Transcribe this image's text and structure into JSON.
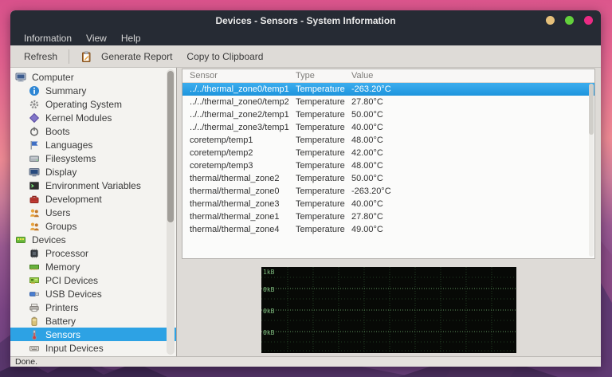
{
  "window": {
    "title": "Devices - Sensors - System Information",
    "controls": [
      {
        "name": "minimize-button",
        "color": "#e5c07b"
      },
      {
        "name": "maximize-button",
        "color": "#63d13c"
      },
      {
        "name": "close-button",
        "color": "#ea2b83"
      }
    ]
  },
  "menu": {
    "items": [
      "Information",
      "View",
      "Help"
    ]
  },
  "toolbar": {
    "refresh_label": "Refresh",
    "generate_report_label": "Generate Report",
    "copy_label": "Copy to Clipboard",
    "generate_report_icon": "clipboard-icon"
  },
  "sidebar": {
    "items": [
      {
        "label": "Computer",
        "icon": "computer-icon",
        "level": 0,
        "selected": false
      },
      {
        "label": "Summary",
        "icon": "info-icon",
        "level": 1,
        "selected": false
      },
      {
        "label": "Operating System",
        "icon": "gear-icon",
        "level": 1,
        "selected": false
      },
      {
        "label": "Kernel Modules",
        "icon": "module-icon",
        "level": 1,
        "selected": false
      },
      {
        "label": "Boots",
        "icon": "power-icon",
        "level": 1,
        "selected": false
      },
      {
        "label": "Languages",
        "icon": "flag-icon",
        "level": 1,
        "selected": false
      },
      {
        "label": "Filesystems",
        "icon": "drive-icon",
        "level": 1,
        "selected": false
      },
      {
        "label": "Display",
        "icon": "display-icon",
        "level": 1,
        "selected": false
      },
      {
        "label": "Environment Variables",
        "icon": "terminal-icon",
        "level": 1,
        "selected": false
      },
      {
        "label": "Development",
        "icon": "toolbox-icon",
        "level": 1,
        "selected": false
      },
      {
        "label": "Users",
        "icon": "users-icon",
        "level": 1,
        "selected": false
      },
      {
        "label": "Groups",
        "icon": "users-icon",
        "level": 1,
        "selected": false
      },
      {
        "label": "Devices",
        "icon": "chip-board-icon",
        "level": 0,
        "selected": false
      },
      {
        "label": "Processor",
        "icon": "processor-icon",
        "level": 1,
        "selected": false
      },
      {
        "label": "Memory",
        "icon": "memory-icon",
        "level": 1,
        "selected": false
      },
      {
        "label": "PCI Devices",
        "icon": "pci-icon",
        "level": 1,
        "selected": false
      },
      {
        "label": "USB Devices",
        "icon": "usb-icon",
        "level": 1,
        "selected": false
      },
      {
        "label": "Printers",
        "icon": "printer-icon",
        "level": 1,
        "selected": false
      },
      {
        "label": "Battery",
        "icon": "battery-icon",
        "level": 1,
        "selected": false
      },
      {
        "label": "Sensors",
        "icon": "thermometer-icon",
        "level": 1,
        "selected": true
      },
      {
        "label": "Input Devices",
        "icon": "keyboard-icon",
        "level": 1,
        "selected": false
      }
    ]
  },
  "table": {
    "columns": [
      "Sensor",
      "Type",
      "Value"
    ],
    "rows": [
      {
        "sensor": "../../thermal_zone0/temp1",
        "type": "Temperature",
        "value": "-263.20°C",
        "selected": true
      },
      {
        "sensor": "../../thermal_zone0/temp2",
        "type": "Temperature",
        "value": "27.80°C",
        "selected": false
      },
      {
        "sensor": "../../thermal_zone2/temp1",
        "type": "Temperature",
        "value": "50.00°C",
        "selected": false
      },
      {
        "sensor": "../../thermal_zone3/temp1",
        "type": "Temperature",
        "value": "40.00°C",
        "selected": false
      },
      {
        "sensor": "coretemp/temp1",
        "type": "Temperature",
        "value": "48.00°C",
        "selected": false
      },
      {
        "sensor": "coretemp/temp2",
        "type": "Temperature",
        "value": "42.00°C",
        "selected": false
      },
      {
        "sensor": "coretemp/temp3",
        "type": "Temperature",
        "value": "48.00°C",
        "selected": false
      },
      {
        "sensor": "thermal/thermal_zone2",
        "type": "Temperature",
        "value": "50.00°C",
        "selected": false
      },
      {
        "sensor": "thermal/thermal_zone0",
        "type": "Temperature",
        "value": "-263.20°C",
        "selected": false
      },
      {
        "sensor": "thermal/thermal_zone3",
        "type": "Temperature",
        "value": "40.00°C",
        "selected": false
      },
      {
        "sensor": "thermal/thermal_zone1",
        "type": "Temperature",
        "value": "27.80°C",
        "selected": false
      },
      {
        "sensor": "thermal/thermal_zone4",
        "type": "Temperature",
        "value": "49.00°C",
        "selected": false
      }
    ]
  },
  "graph": {
    "axis_labels": [
      "1kB",
      "0kB",
      "0kB",
      "0kB"
    ],
    "grid_color_dim": "#223d22",
    "grid_color_bright": "#5f955f",
    "label_color": "#7fbd7f"
  },
  "status": {
    "text": "Done."
  }
}
